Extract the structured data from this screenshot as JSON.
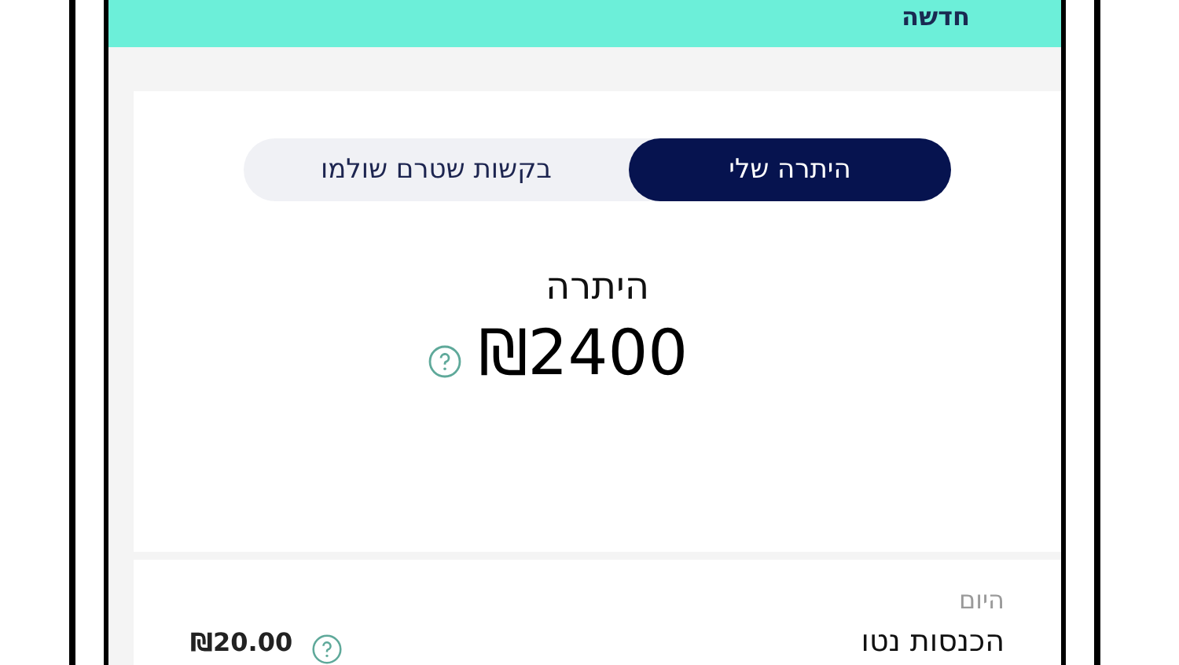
{
  "header": {
    "title": "חדשה"
  },
  "tabs": [
    {
      "label": "היתרה שלי",
      "selected": true
    },
    {
      "label": "בקשות שטרם שולמו",
      "selected": false
    }
  ],
  "balance": {
    "label": "היתרה",
    "amount": "₪2400"
  },
  "summary": {
    "period": "היום",
    "label": "הכנסות נטו",
    "value": "₪20.00"
  }
}
